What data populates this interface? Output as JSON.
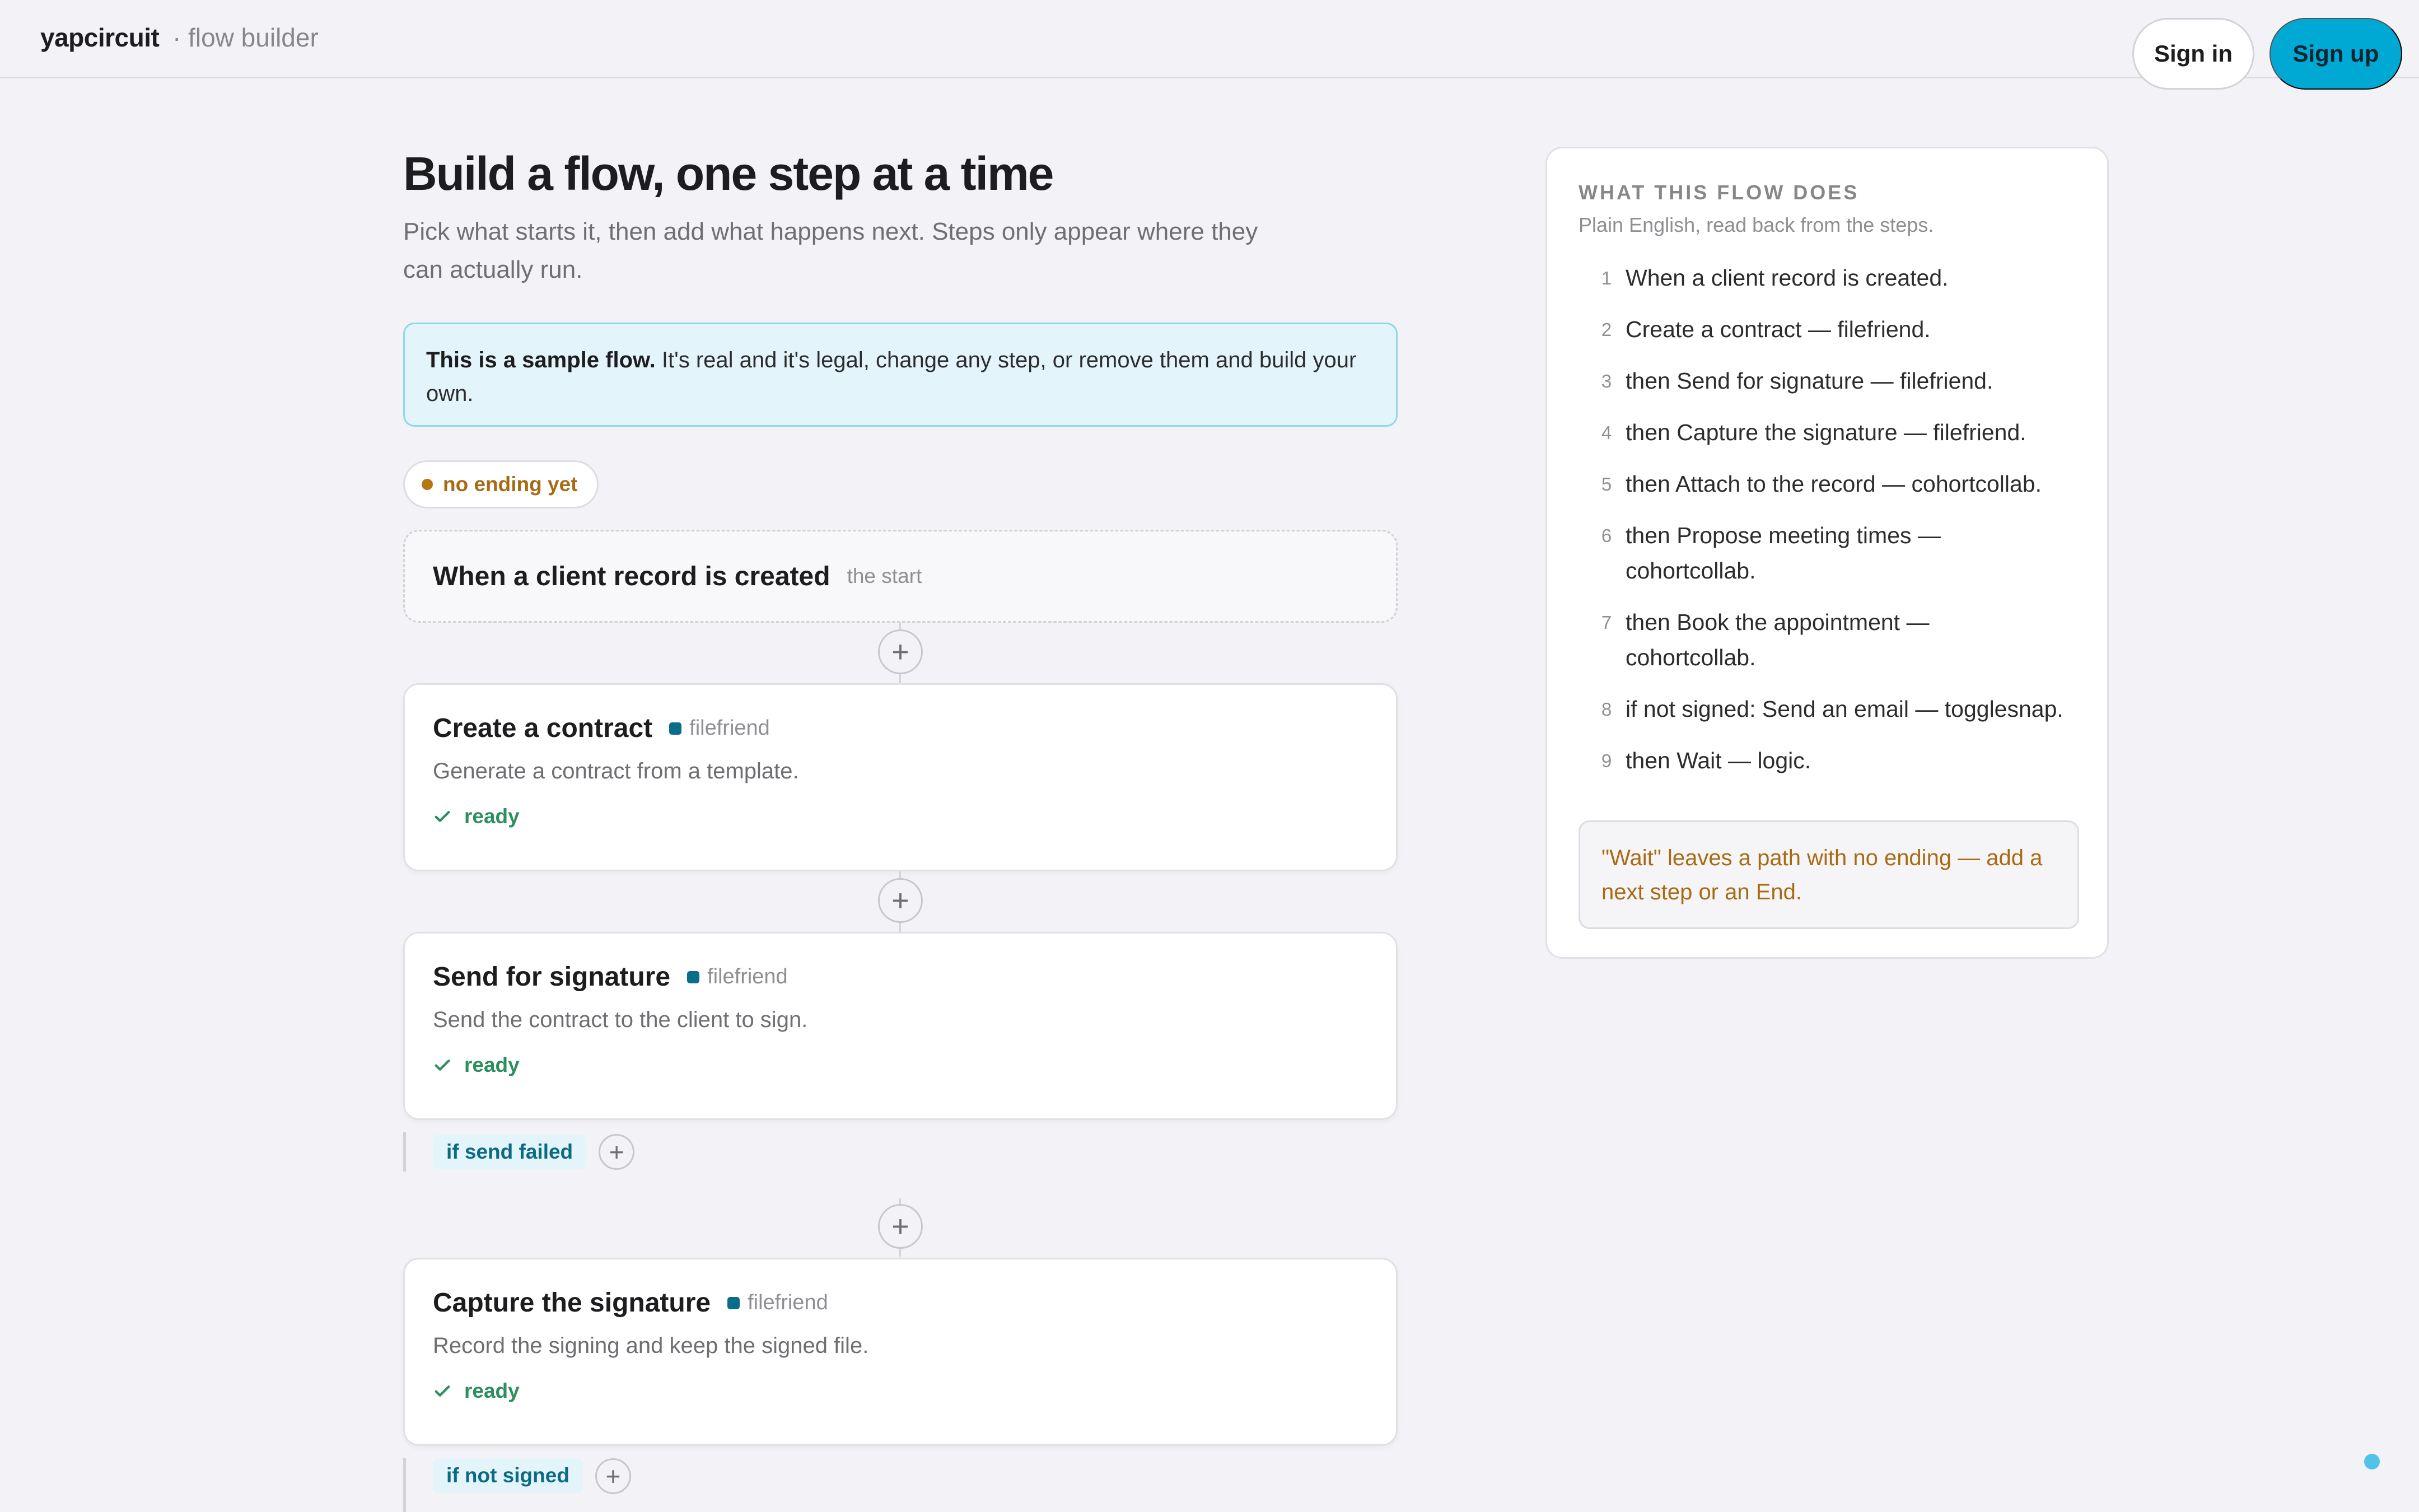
{
  "header": {
    "brand": "yapcircuit",
    "subtitle": "· flow builder",
    "sign_in_label": "Sign in",
    "sign_up_label": "Sign up"
  },
  "main": {
    "title": "Build a flow, one step at a time",
    "subtitle": "Pick what starts it, then add what happens next. Steps only appear where they can actually run.",
    "sample_note_bold": "This is a sample flow.",
    "sample_note_text": " It's real and it's legal, change any step, or remove them and build your own.",
    "status_pill": "no ending yet",
    "trigger": {
      "title": "When a client record is created",
      "tag": "the start"
    },
    "steps": [
      {
        "title": "Create a contract",
        "app": "filefriend",
        "description": "Generate a contract from a template.",
        "status": "ready"
      },
      {
        "title": "Send for signature",
        "app": "filefriend",
        "description": "Send the contract to the client to sign.",
        "status": "ready",
        "branch": "if send failed"
      },
      {
        "title": "Capture the signature",
        "app": "filefriend",
        "description": "Record the signing and keep the signed file.",
        "status": "ready",
        "branch": "if not signed"
      }
    ],
    "add_step_glyph": "+",
    "app_color": "#0a6e8a",
    "accent_color": "#00a9d4",
    "ready_color": "#2d8f5f",
    "warning_color": "#a86b13"
  },
  "summary": {
    "title": "WHAT THIS FLOW DOES",
    "subtitle": "Plain English, read back from the steps.",
    "items": [
      {
        "num": "1",
        "text": "When a client record is created."
      },
      {
        "num": "2",
        "text": "Create a contract — filefriend."
      },
      {
        "num": "3",
        "text": "then Send for signature — filefriend."
      },
      {
        "num": "4",
        "text": "then Capture the signature — filefriend."
      },
      {
        "num": "5",
        "text": "then Attach to the record — cohortcollab."
      },
      {
        "num": "6",
        "text": "then Propose meeting times — cohortcollab."
      },
      {
        "num": "7",
        "text": "then Book the appointment — cohortcollab."
      },
      {
        "num": "8",
        "text": "if not signed: Send an email — togglesnap."
      },
      {
        "num": "9",
        "text": "then Wait — logic."
      }
    ],
    "warning": "\"Wait\" leaves a path with no ending — add a next step or an End."
  }
}
